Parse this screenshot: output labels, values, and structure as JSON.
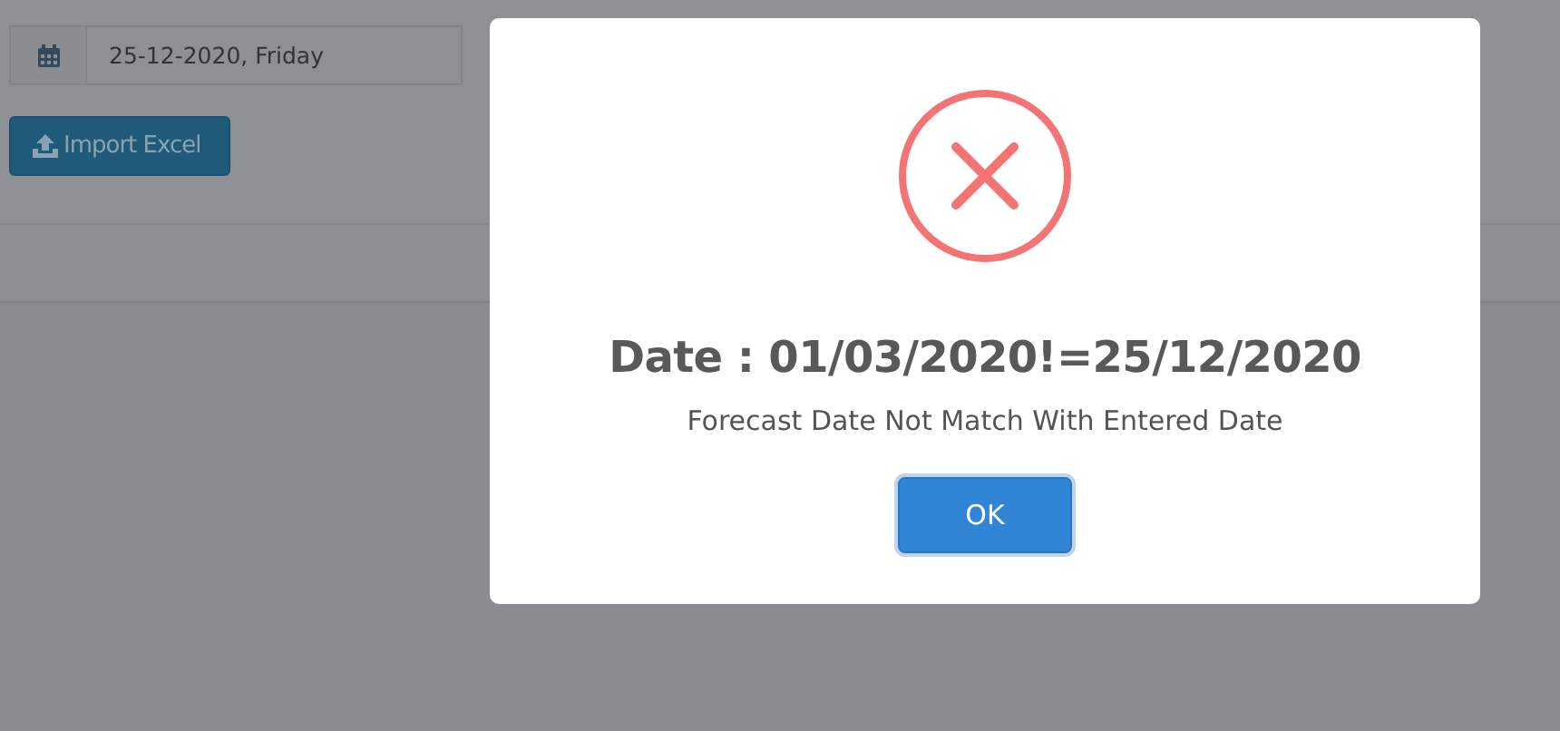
{
  "date_field": {
    "value": "25-12-2020, Friday"
  },
  "import_button": {
    "label": "Import Excel"
  },
  "dialog": {
    "kind": "error",
    "title": "Date : 01/03/2020!=25/12/2020",
    "message": "Forecast Date Not Match With Entered Date",
    "confirm_button": "OK"
  }
}
